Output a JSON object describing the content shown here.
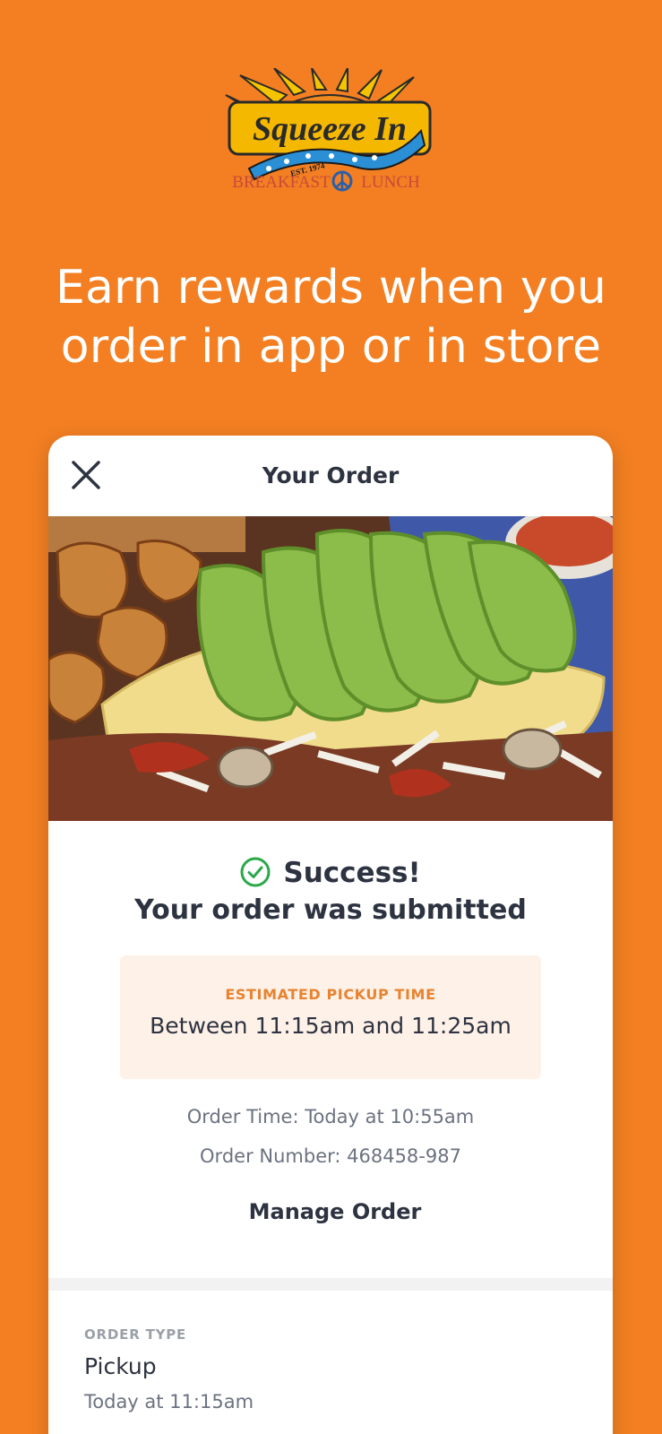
{
  "brand": {
    "logo_name": "Squeeze In",
    "logo_est": "EST. 1974",
    "logo_tagline_left": "BREAKFAST",
    "logo_tagline_right": "LUNCH",
    "background_color": "#f37f22"
  },
  "headline": {
    "line1": "Earn rewards when you",
    "line2": "order in app or in store"
  },
  "card": {
    "close_icon": "close-icon",
    "title": "Your Order",
    "photo_icon": "food-photo"
  },
  "confirmation": {
    "success_icon": "check-circle-icon",
    "success_text": "Success!",
    "submitted_text": "Your order was submitted",
    "accent_color": "#2aa84a"
  },
  "pickup": {
    "label": "ESTIMATED PICKUP TIME",
    "value": "Between 11:15am and 11:25am",
    "label_color": "#e8832f"
  },
  "details": {
    "order_time": "Order Time: Today at 10:55am",
    "order_number": "Order Number: 468458-987",
    "manage_label": "Manage Order"
  },
  "order_type": {
    "label": "ORDER TYPE",
    "value": "Pickup",
    "time": "Today at 11:15am"
  }
}
